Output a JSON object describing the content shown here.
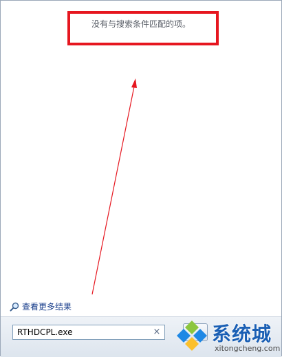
{
  "results": {
    "no_results_text": "没有与搜索条件匹配的项。",
    "see_more_label": "查看更多结果"
  },
  "search": {
    "value": "RTHDCPL.exe",
    "clear_symbol": "×"
  },
  "watermark": {
    "brand": "系统城",
    "domain": "xitongcheng.com"
  },
  "colors": {
    "annotation_red": "#e6161f",
    "link_blue": "#1a3f8c",
    "brand_blue": "#1a5fb4"
  },
  "icons": {
    "see_more": "magnifier-icon",
    "clear": "close-icon",
    "logo": "windows-logo-icon"
  }
}
